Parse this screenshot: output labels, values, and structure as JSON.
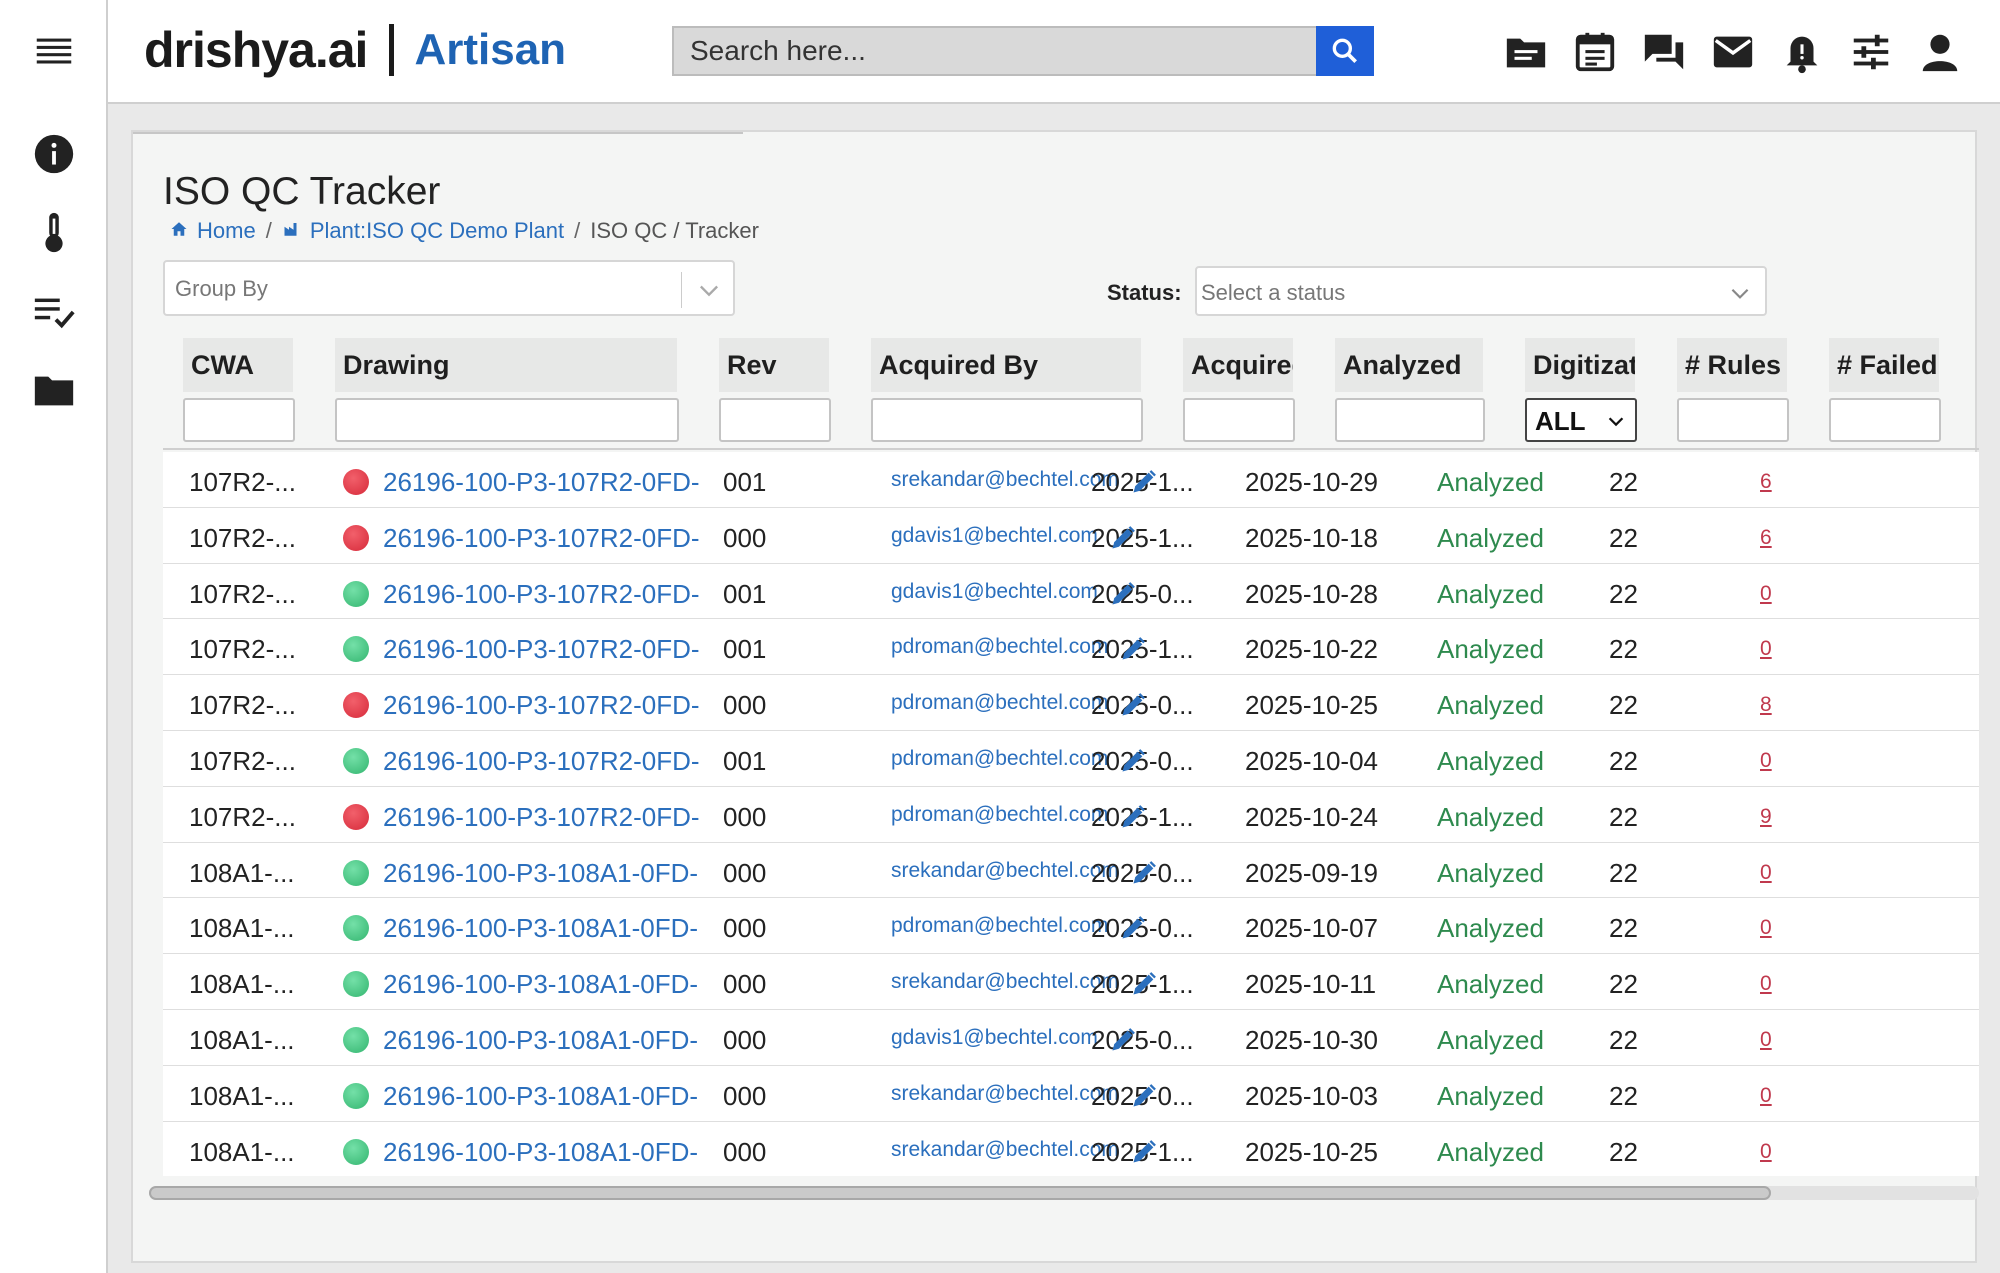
{
  "brand": {
    "name": "drishya.ai",
    "product": "Artisan"
  },
  "search": {
    "placeholder": "Search here..."
  },
  "sidebar": {
    "items": [
      {
        "name": "menu",
        "icon": "hamburger-menu-icon"
      },
      {
        "name": "info",
        "icon": "info-icon"
      },
      {
        "name": "thermometer",
        "icon": "thermometer-icon"
      },
      {
        "name": "checklist",
        "icon": "checklist-icon"
      },
      {
        "name": "folder",
        "icon": "folder-icon"
      }
    ]
  },
  "header_icons": [
    "folder-shared-icon",
    "calendar-icon",
    "chat-icon",
    "mail-icon",
    "bell-icon",
    "sliders-icon",
    "user-icon"
  ],
  "page": {
    "title": "ISO QC Tracker",
    "breadcrumb": {
      "home": "Home",
      "plant": "Plant:ISO QC Demo Plant",
      "current": "ISO QC / Tracker"
    }
  },
  "filters": {
    "group_by_placeholder": "Group By",
    "status_label": "Status:",
    "status_placeholder": "Select a status",
    "digitization_value": "ALL"
  },
  "table": {
    "columns": [
      "CWA",
      "Drawing",
      "Rev",
      "Acquired By",
      "Acquired",
      "Analyzed",
      "Digitization",
      "# Rules",
      "# Failed"
    ],
    "rows": [
      {
        "cwa": "107R2-...",
        "status": "red",
        "drawing": "26196-100-P3-107R2-0FD-",
        "rev": "001",
        "acquired_by": "srekandar@bechtel.com",
        "acquired": "2025-1...",
        "analyzed": "2025-10-29",
        "digitization": "Analyzed",
        "rules": "22",
        "failed": "6"
      },
      {
        "cwa": "107R2-...",
        "status": "red",
        "drawing": "26196-100-P3-107R2-0FD-",
        "rev": "000",
        "acquired_by": "gdavis1@bechtel.com",
        "acquired": "2025-1...",
        "analyzed": "2025-10-18",
        "digitization": "Analyzed",
        "rules": "22",
        "failed": "6"
      },
      {
        "cwa": "107R2-...",
        "status": "green",
        "drawing": "26196-100-P3-107R2-0FD-",
        "rev": "001",
        "acquired_by": "gdavis1@bechtel.com",
        "acquired": "2025-0...",
        "analyzed": "2025-10-28",
        "digitization": "Analyzed",
        "rules": "22",
        "failed": "0"
      },
      {
        "cwa": "107R2-...",
        "status": "green",
        "drawing": "26196-100-P3-107R2-0FD-",
        "rev": "001",
        "acquired_by": "pdroman@bechtel.com",
        "acquired": "2025-1...",
        "analyzed": "2025-10-22",
        "digitization": "Analyzed",
        "rules": "22",
        "failed": "0"
      },
      {
        "cwa": "107R2-...",
        "status": "red",
        "drawing": "26196-100-P3-107R2-0FD-",
        "rev": "000",
        "acquired_by": "pdroman@bechtel.com",
        "acquired": "2025-0...",
        "analyzed": "2025-10-25",
        "digitization": "Analyzed",
        "rules": "22",
        "failed": "8"
      },
      {
        "cwa": "107R2-...",
        "status": "green",
        "drawing": "26196-100-P3-107R2-0FD-",
        "rev": "001",
        "acquired_by": "pdroman@bechtel.com",
        "acquired": "2025-0...",
        "analyzed": "2025-10-04",
        "digitization": "Analyzed",
        "rules": "22",
        "failed": "0"
      },
      {
        "cwa": "107R2-...",
        "status": "red",
        "drawing": "26196-100-P3-107R2-0FD-",
        "rev": "000",
        "acquired_by": "pdroman@bechtel.com",
        "acquired": "2025-1...",
        "analyzed": "2025-10-24",
        "digitization": "Analyzed",
        "rules": "22",
        "failed": "9"
      },
      {
        "cwa": "108A1-...",
        "status": "green",
        "drawing": "26196-100-P3-108A1-0FD-",
        "rev": "000",
        "acquired_by": "srekandar@bechtel.com",
        "acquired": "2025-0...",
        "analyzed": "2025-09-19",
        "digitization": "Analyzed",
        "rules": "22",
        "failed": "0"
      },
      {
        "cwa": "108A1-...",
        "status": "green",
        "drawing": "26196-100-P3-108A1-0FD-",
        "rev": "000",
        "acquired_by": "pdroman@bechtel.com",
        "acquired": "2025-0...",
        "analyzed": "2025-10-07",
        "digitization": "Analyzed",
        "rules": "22",
        "failed": "0"
      },
      {
        "cwa": "108A1-...",
        "status": "green",
        "drawing": "26196-100-P3-108A1-0FD-",
        "rev": "000",
        "acquired_by": "srekandar@bechtel.com",
        "acquired": "2025-1...",
        "analyzed": "2025-10-11",
        "digitization": "Analyzed",
        "rules": "22",
        "failed": "0"
      },
      {
        "cwa": "108A1-...",
        "status": "green",
        "drawing": "26196-100-P3-108A1-0FD-",
        "rev": "000",
        "acquired_by": "gdavis1@bechtel.com",
        "acquired": "2025-0...",
        "analyzed": "2025-10-30",
        "digitization": "Analyzed",
        "rules": "22",
        "failed": "0"
      },
      {
        "cwa": "108A1-...",
        "status": "green",
        "drawing": "26196-100-P3-108A1-0FD-",
        "rev": "000",
        "acquired_by": "srekandar@bechtel.com",
        "acquired": "2025-0...",
        "analyzed": "2025-10-03",
        "digitization": "Analyzed",
        "rules": "22",
        "failed": "0"
      },
      {
        "cwa": "108A1-...",
        "status": "green",
        "drawing": "26196-100-P3-108A1-0FD-",
        "rev": "000",
        "acquired_by": "srekandar@bechtel.com",
        "acquired": "2025-1...",
        "analyzed": "2025-10-25",
        "digitization": "Analyzed",
        "rules": "22",
        "failed": "0"
      }
    ]
  },
  "colors": {
    "brand_blue": "#1e63b3",
    "search_button": "#1f5fd8",
    "link": "#2b6fbd",
    "status_failed": "#d62a3a",
    "status_passed": "#33b56f",
    "digitization_text": "#2e8a4e",
    "failed_count": "#c0394d"
  }
}
